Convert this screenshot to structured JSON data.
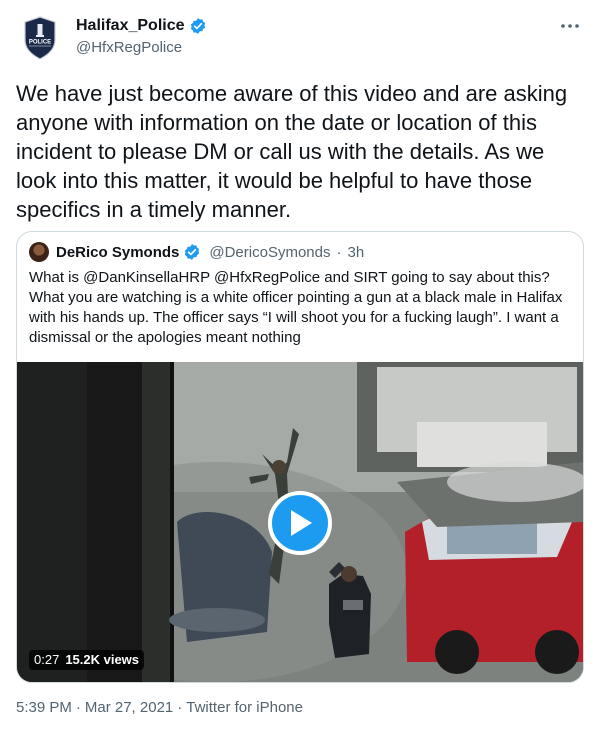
{
  "author": {
    "display_name": "Halifax_Police",
    "handle": "@HfxRegPolice",
    "avatar_label": "POLICE",
    "verified_icon": "verified-badge-icon",
    "more_icon": "more-horizontal-icon"
  },
  "tweet": {
    "text": "We have just become aware of this video and are asking anyone with information on the date or location of this incident to please DM or call us with the details. As we look into this matter, it would be helpful to have those specifics in a timely manner.",
    "time": "5:39 PM",
    "date": "Mar 27, 2021",
    "source": "Twitter for iPhone",
    "separator": "·"
  },
  "quote": {
    "display_name": "DeRico Symonds",
    "handle": "@DericoSymonds",
    "separator": "·",
    "time": "3h",
    "text": "What is @DanKinsellaHRP @HfxRegPolice and SIRT going to say about this? What you are watching is a white officer pointing a gun at a black male in Halifax with his hands up. The officer says “I will shoot you for a fucking laugh”. I want a dismissal or the apologies meant nothing",
    "video": {
      "duration": "0:27",
      "views": "15.2K views",
      "play_icon": "play-icon"
    }
  },
  "colors": {
    "accent": "#1d9bf0",
    "text": "#0f1419",
    "secondary_text": "#536471",
    "border": "#cfd9de"
  }
}
